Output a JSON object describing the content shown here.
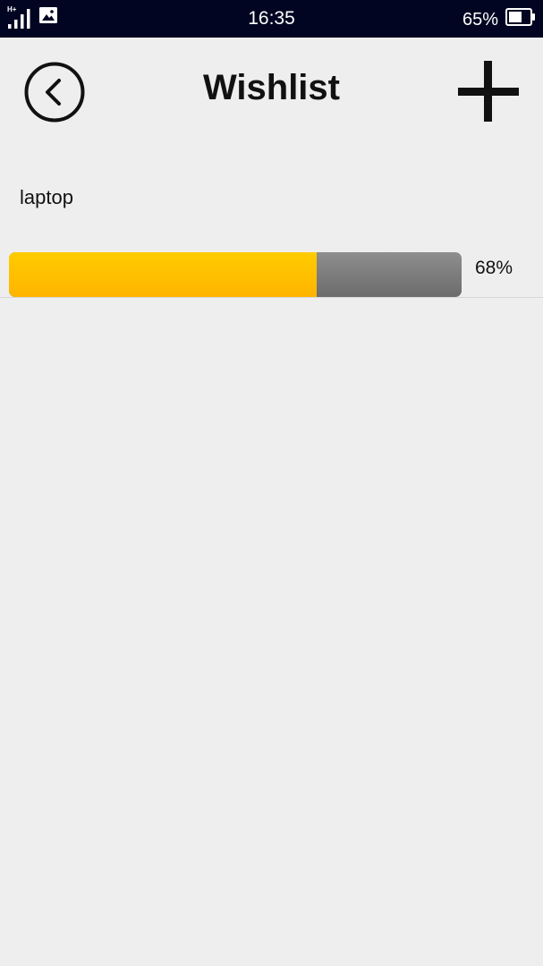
{
  "status_bar": {
    "network_type": "H+",
    "time": "16:35",
    "battery_percent": "65%",
    "battery_level": 0.65
  },
  "header": {
    "title": "Wishlist",
    "back_icon": "back-arrow-circle-icon",
    "add_icon": "plus-icon"
  },
  "wishlist": {
    "items": [
      {
        "name": "laptop",
        "progress": 0.68,
        "progress_label": "68%"
      }
    ]
  },
  "colors": {
    "status_bar_bg": "#020522",
    "background": "#eeeeee",
    "progress_fill": "#ffbf00",
    "progress_track": "#7a7a7a",
    "text": "#111111"
  }
}
